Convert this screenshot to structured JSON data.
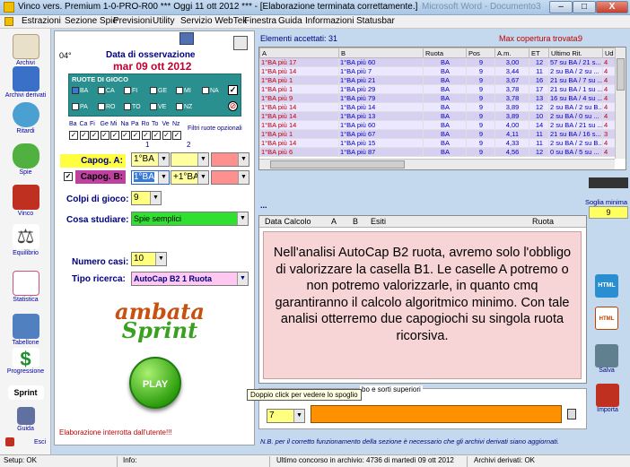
{
  "window": {
    "title": "Vinco vers. Premium  1-0-PRO-R00  ***  Oggi 11 ott 2012  ***  - [Elaborazione terminata correttamente.]",
    "ghost_title": "Microsoft Word - Documento3",
    "min": "–",
    "max": "□",
    "close": "X"
  },
  "menu": [
    "Estrazioni",
    "Sezione Spie",
    "Previsioni",
    "Utility",
    "Servizio WebTek",
    "Finestra",
    "Guida",
    "Informazioni",
    "Statusbar"
  ],
  "sidebar": [
    {
      "label": "Archivi",
      "icon": "pencil-icon",
      "color": "#e8e0c8"
    },
    {
      "label": "Archivi derivati",
      "icon": "archive-derived-icon",
      "color": "#3a70c8"
    },
    {
      "label": "Ritardi",
      "icon": "clock-icon",
      "color": "#4aa0d0"
    },
    {
      "label": "Spie",
      "icon": "spie-icon",
      "color": "#50b040"
    },
    {
      "label": "Vinco",
      "icon": "vinco-icon",
      "color": "#c03020"
    },
    {
      "label": "Equilibrio",
      "icon": "scales-icon",
      "color": "#707070"
    },
    {
      "label": "Statistica",
      "icon": "chart-icon",
      "color": "#d05080"
    },
    {
      "label": "Tabellone",
      "icon": "grid-icon",
      "color": "#5080c0"
    },
    {
      "label": "Progressione",
      "icon": "dollar-icon",
      "color": "#209030"
    },
    {
      "label": "Sprint",
      "icon": "sprint-icon",
      "color": "#f0c020"
    },
    {
      "label": "Guida",
      "icon": "book-icon",
      "color": "#6070a0"
    }
  ],
  "sidebar_exit": "Esci",
  "left": {
    "deg": "04°",
    "date_title": "Data di osservazione",
    "date_value": "mar 09 ott 2012",
    "ruote_title": "RUOTE DI GIOCO",
    "ruote_row1": [
      "BA",
      "CA",
      "FI",
      "GE",
      "MI",
      "NA"
    ],
    "ruote_row2": [
      "PA",
      "RO",
      "TO",
      "VE",
      "NZ"
    ],
    "ruote_abbr": [
      "Ba",
      "Ca",
      "Fi",
      "Ge",
      "Mi",
      "Na",
      "Pa",
      "Ro",
      "To",
      "Ve",
      "Nz"
    ],
    "filtri": "Filtri ruote opzionali",
    "col1": "1",
    "col2": "2",
    "capog_a": "Capog. A:",
    "capog_a_val": "1°BA",
    "capog_b": "Capog. B:",
    "capog_b_val": "1°BA",
    "capog_b_val2": "+1°BA",
    "colpi_label": "Colpi di gioco:",
    "colpi_val": "9",
    "cosa_label": "Cosa studiare:",
    "cosa_val": "Spie semplici",
    "numero_label": "Numero casi:",
    "numero_val": "10",
    "tipo_label": "Tipo ricerca:",
    "tipo_val": "AutoCap B2 1 Ruota",
    "logo1": "ambata",
    "logo2": "Sprint",
    "play": "PLAY",
    "interrupted": "Elaborazione interrotta dall'utente!!!"
  },
  "top": {
    "accepted": "Elementi accettati: 31",
    "max_cov_label": "Max copertura trovata:",
    "max_cov_val": "9"
  },
  "table": {
    "headers": [
      "A",
      "B",
      "Ruota",
      "Pos",
      "A.m.",
      "ET",
      "Ultimo Rit.",
      "Ud"
    ],
    "rows": [
      [
        "1°BA  più 17",
        "1°BA  più 60",
        "BA",
        "9",
        "3,00",
        "12",
        "57 su BA / 21 s...",
        "4"
      ],
      [
        "1°BA  più 14",
        "1°BA  più 7",
        "BA",
        "9",
        "3,44",
        "11",
        "2 su BA / 2 su ...",
        "4"
      ],
      [
        "1°BA  più 1",
        "1°BA  più 21",
        "BA",
        "9",
        "3,67",
        "16",
        "21 su BA / 7 su ...",
        "4"
      ],
      [
        "1°BA  più 1",
        "1°BA  più 29",
        "BA",
        "9",
        "3,78",
        "17",
        "21 su BA / 1 su ...",
        "4"
      ],
      [
        "1°BA  più 9",
        "1°BA  più 79",
        "BA",
        "9",
        "3,78",
        "13",
        "16 su BA / 4 su ...",
        "4"
      ],
      [
        "1°BA  più 14",
        "1°BA  più 14",
        "BA",
        "9",
        "3,89",
        "12",
        "2 su BA / 2 su B...",
        "4"
      ],
      [
        "1°BA  più 14",
        "1°BA  più 13",
        "BA",
        "9",
        "3,89",
        "10",
        "2 su BA / 0 su ...",
        "4"
      ],
      [
        "1°BA  più 14",
        "1°BA  più 60",
        "BA",
        "9",
        "4,00",
        "14",
        "2 su BA / 21 su ...",
        "4"
      ],
      [
        "1°BA  più 1",
        "1°BA  più 67",
        "BA",
        "9",
        "4,11",
        "11",
        "21 su BA / 16 s...",
        "3"
      ],
      [
        "1°BA  più 14",
        "1°BA  più 15",
        "BA",
        "9",
        "4,33",
        "11",
        "2 su BA / 2 su B...",
        "4"
      ],
      [
        "1°BA  più 6",
        "1°BA  più 87",
        "BA",
        "9",
        "4,56",
        "12",
        "0 su BA / 5 su ...",
        "4"
      ]
    ]
  },
  "dots": "...",
  "soglia_label": "Soglia minima",
  "soglia_val": "9",
  "results": {
    "headers": [
      "Data Calcolo",
      "A",
      "B",
      "Esiti",
      "Ruota"
    ],
    "info": "Nell'analisi AutoCap B2 ruota, avremo solo l'obbligo di valorizzare la casella B1. Le caselle A potremo o non potremo valorizzarle, in quanto cmq garantiranno il calcolo algoritmico minimo. Con tale analisi otterremo due capogiochi su singola ruota ricorsiva."
  },
  "tooltip": "Doppio click per vedere lo spoglio",
  "sorti_label": "bo e sorti superiori",
  "sorti_val": "7",
  "note": "N.B. per il corretto funzionamento della sezione è necessario che gli archivi derivati siano aggiornati.",
  "right_buttons": {
    "html1": "HTML",
    "html2": "HTML",
    "salva": "Salva",
    "importa": "Importa"
  },
  "status": {
    "setup": "Setup: OK",
    "info": "Info:",
    "ultimo": "Ultimo concorso in archivio: 4736 di martedì 09 ott 2012",
    "derivati": "Archivi derivati: OK"
  }
}
